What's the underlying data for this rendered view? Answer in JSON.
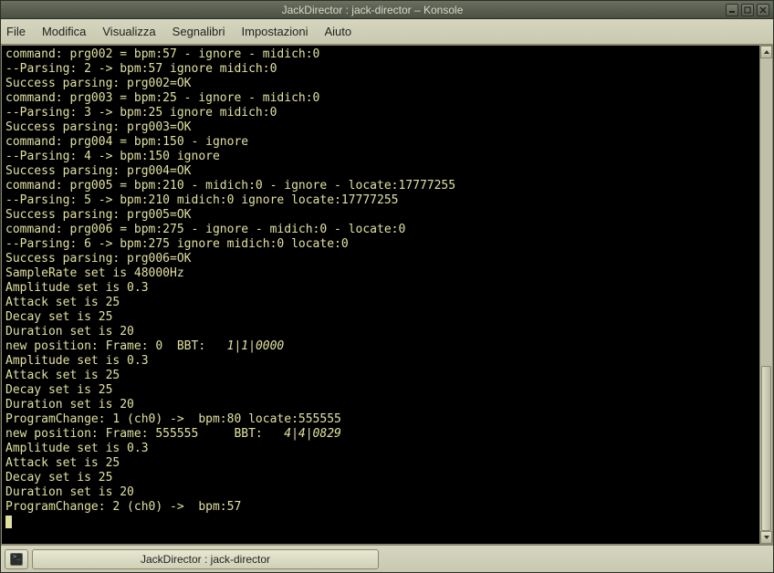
{
  "window": {
    "title": "JackDirector : jack-director – Konsole"
  },
  "menu": {
    "items": [
      "File",
      "Modifica",
      "Visualizza",
      "Segnalibri",
      "Impostazioni",
      "Aiuto"
    ]
  },
  "terminal": {
    "lines": [
      {
        "t": "command: prg002 = bpm:57 - ignore - midich:0"
      },
      {
        "t": "--Parsing: 2 -> bpm:57 ignore midich:0"
      },
      {
        "t": "Success parsing: prg002=OK"
      },
      {
        "t": "command: prg003 = bpm:25 - ignore - midich:0"
      },
      {
        "t": "--Parsing: 3 -> bpm:25 ignore midich:0"
      },
      {
        "t": "Success parsing: prg003=OK"
      },
      {
        "t": "command: prg004 = bpm:150 - ignore"
      },
      {
        "t": "--Parsing: 4 -> bpm:150 ignore"
      },
      {
        "t": "Success parsing: prg004=OK"
      },
      {
        "t": "command: prg005 = bpm:210 - midich:0 - ignore - locate:17777255"
      },
      {
        "t": "--Parsing: 5 -> bpm:210 midich:0 ignore locate:17777255"
      },
      {
        "t": "Success parsing: prg005=OK"
      },
      {
        "t": "command: prg006 = bpm:275 - ignore - midich:0 - locate:0"
      },
      {
        "t": "--Parsing: 6 -> bpm:275 ignore midich:0 locate:0"
      },
      {
        "t": "Success parsing: prg006=OK"
      },
      {
        "t": "SampleRate set is 48000Hz"
      },
      {
        "t": "Amplitude set is 0.3"
      },
      {
        "t": "Attack set is 25"
      },
      {
        "t": "Decay set is 25"
      },
      {
        "t": "Duration set is 20"
      },
      {
        "pre": "new position: Frame: 0  BBT:   ",
        "bbt": "1|1|0000"
      },
      {
        "t": "Amplitude set is 0.3"
      },
      {
        "t": "Attack set is 25"
      },
      {
        "t": "Decay set is 25"
      },
      {
        "t": "Duration set is 20"
      },
      {
        "t": "ProgramChange: 1 (ch0) ->  bpm:80 locate:555555"
      },
      {
        "pre": "new position: Frame: 555555     BBT:   ",
        "bbt": "4|4|0829"
      },
      {
        "t": "Amplitude set is 0.3"
      },
      {
        "t": "Attack set is 25"
      },
      {
        "t": "Decay set is 25"
      },
      {
        "t": "Duration set is 20"
      },
      {
        "t": "ProgramChange: 2 (ch0) ->  bpm:57"
      }
    ]
  },
  "taskbar": {
    "tab_label": "JackDirector : jack-director"
  }
}
